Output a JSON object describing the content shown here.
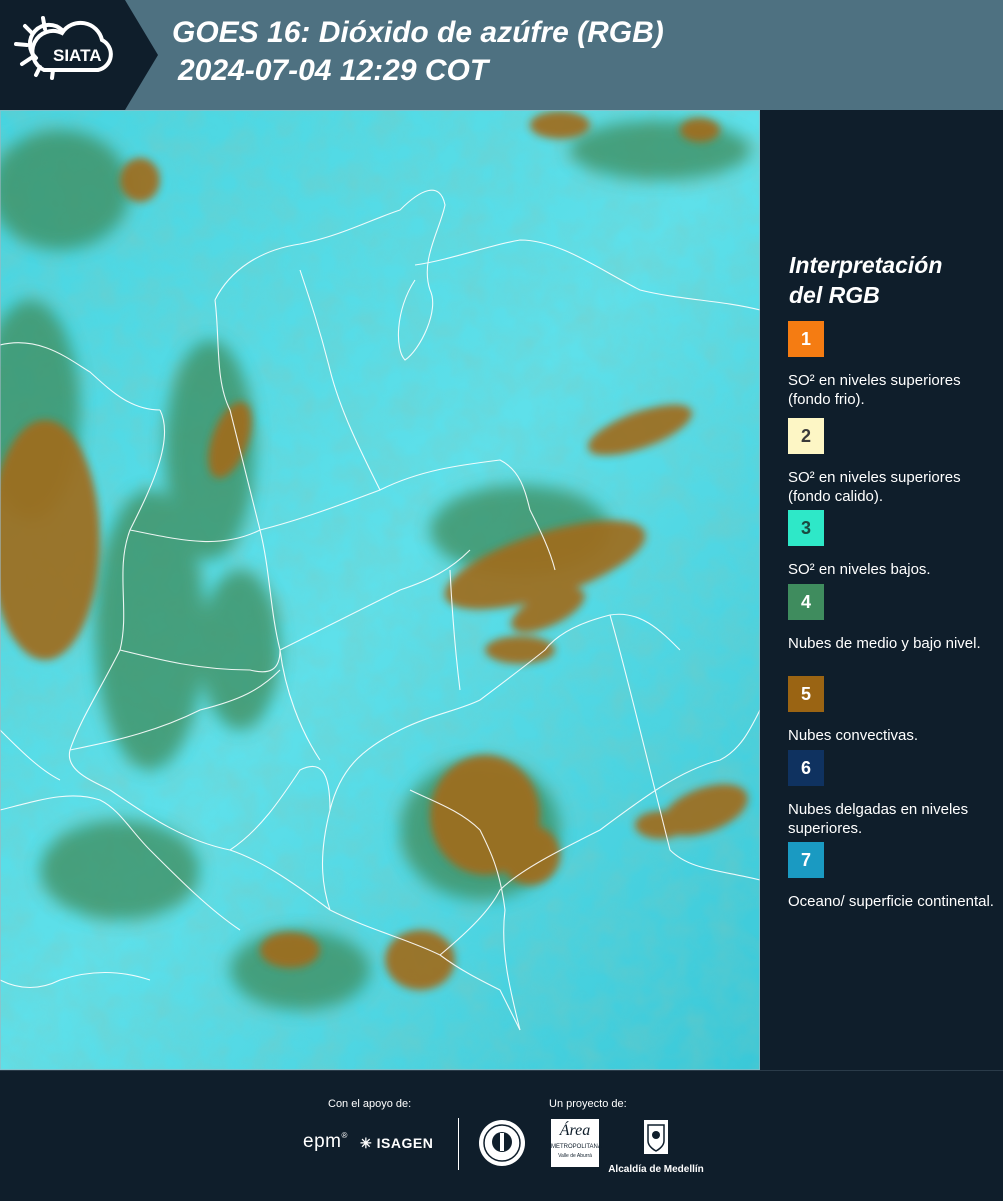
{
  "header": {
    "logo_text": "SIATA",
    "title_line1": "GOES 16: Dióxido de azúfre (RGB)",
    "title_line2": "2024-07-04 12:29 COT"
  },
  "legend": {
    "title_line1": "Interpretación",
    "title_line2": "del RGB",
    "items": [
      {
        "num": "1",
        "label": "SO² en niveles superiores (fondo frio).",
        "color": "#f57c12",
        "text_color": "#ffffff"
      },
      {
        "num": "2",
        "label": "SO² en niveles superiores (fondo calido).",
        "color": "#fdf6c5",
        "text_color": "#3a3a3a"
      },
      {
        "num": "3",
        "label": "SO² en niveles bajos.",
        "color": "#2ee8c8",
        "text_color": "#1a4a40"
      },
      {
        "num": "4",
        "label": "Nubes de medio y bajo nivel.",
        "color": "#3f8c5e",
        "text_color": "#ffffff"
      },
      {
        "num": "5",
        "label": "Nubes convectivas.",
        "color": "#9a6413",
        "text_color": "#ffffff"
      },
      {
        "num": "6",
        "label": "Nubes delgadas en niveles superiores.",
        "color": "#0f3260",
        "text_color": "#ffffff"
      },
      {
        "num": "7",
        "label": "Oceano/ superficie continental.",
        "color": "#1a9ac2",
        "text_color": "#ffffff"
      }
    ]
  },
  "footer": {
    "support_label": "Con el apoyo de:",
    "project_label": "Un proyecto de:",
    "epm": "epm",
    "isagen": "ISAGEN",
    "area_line1": "Área",
    "area_line2": "METROPOLITANA",
    "area_line3": "Valle de Aburrá",
    "alcaldia": "Alcaldía de Medellín"
  },
  "colors": {
    "header_bg": "#4e7181",
    "logo_bg": "#0f1e2b",
    "panel_bg": "#0f1e2b",
    "map_sky": "#3fd8e6",
    "map_cloud_green": "#3a8a5a",
    "map_convective": "#9a6a1c"
  }
}
